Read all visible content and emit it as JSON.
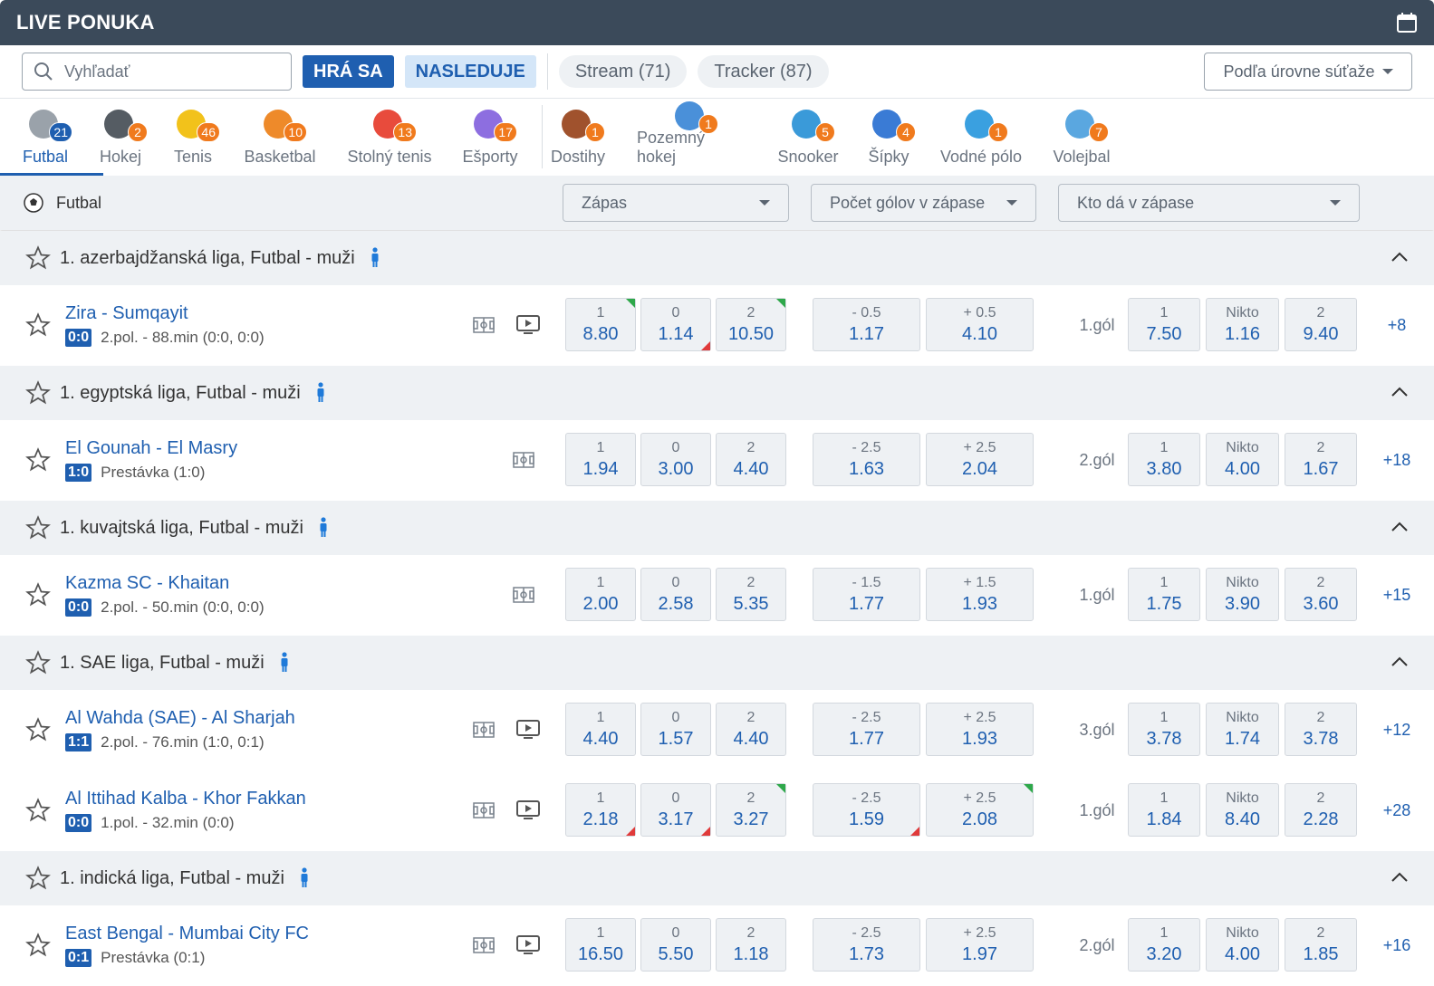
{
  "header": {
    "title": "LIVE PONUKA"
  },
  "filters": {
    "search_placeholder": "Vyhľadať",
    "playing_label": "HRÁ SA",
    "upcoming_label": "NASLEDUJE",
    "stream_label": "Stream (71)",
    "tracker_label": "Tracker (87)",
    "sort_label": "Podľa úrovne súťaže"
  },
  "sports": [
    {
      "name": "Futbal",
      "count": "21",
      "color": "#9aa2aa"
    },
    {
      "name": "Hokej",
      "count": "2",
      "color": "#555c63"
    },
    {
      "name": "Tenis",
      "count": "46",
      "color": "#f2c21b"
    },
    {
      "name": "Basketbal",
      "count": "10",
      "color": "#ee8a2a"
    },
    {
      "name": "Stolný tenis",
      "count": "13",
      "color": "#e84b3c"
    },
    {
      "name": "Ešporty",
      "count": "17",
      "color": "#8d6ee0"
    },
    {
      "name": "Dostihy",
      "count": "1",
      "color": "#a0522d"
    },
    {
      "name": "Pozemný hokej",
      "count": "1",
      "color": "#4a90d9"
    },
    {
      "name": "Snooker",
      "count": "5",
      "color": "#3a9ad9"
    },
    {
      "name": "Šípky",
      "count": "4",
      "color": "#3a7bd5"
    },
    {
      "name": "Vodné pólo",
      "count": "1",
      "color": "#3aa0e0"
    },
    {
      "name": "Volejbal",
      "count": "7",
      "color": "#5aa7e0"
    }
  ],
  "market_bar": {
    "sport_label": "Futbal",
    "dd1": "Zápas",
    "dd2": "Počet gólov v zápase",
    "dd3": "Kto dá v zápase"
  },
  "leagues": [
    {
      "name": "1. azerbajdžanská liga, Futbal - muži",
      "matches": [
        {
          "teams": "Zira - Sumqayit",
          "score": "0:0",
          "status": "2.pol. - 88.min (0:0, 0:0)",
          "tv": true,
          "odds": [
            {
              "l": "1",
              "v": "8.80"
            },
            {
              "l": "0",
              "v": "1.14"
            },
            {
              "l": "2",
              "v": "10.50"
            },
            {
              "l": "- 0.5",
              "v": "1.17"
            },
            {
              "l": "+ 0.5",
              "v": "4.10"
            }
          ],
          "goal": "1.gól",
          "odds2": [
            {
              "l": "1",
              "v": "7.50"
            },
            {
              "l": "Nikto",
              "v": "1.16"
            },
            {
              "l": "2",
              "v": "9.40"
            }
          ],
          "more": "+8"
        }
      ]
    },
    {
      "name": "1. egyptská liga, Futbal - muži",
      "matches": [
        {
          "teams": "El Gounah - El Masry",
          "score": "1:0",
          "status": "Prestávka (1:0)",
          "tv": false,
          "odds": [
            {
              "l": "1",
              "v": "1.94"
            },
            {
              "l": "0",
              "v": "3.00"
            },
            {
              "l": "2",
              "v": "4.40"
            },
            {
              "l": "- 2.5",
              "v": "1.63"
            },
            {
              "l": "+ 2.5",
              "v": "2.04"
            }
          ],
          "goal": "2.gól",
          "odds2": [
            {
              "l": "1",
              "v": "3.80"
            },
            {
              "l": "Nikto",
              "v": "4.00"
            },
            {
              "l": "2",
              "v": "1.67"
            }
          ],
          "more": "+18"
        }
      ]
    },
    {
      "name": "1. kuvajtská liga, Futbal - muži",
      "matches": [
        {
          "teams": "Kazma SC - Khaitan",
          "score": "0:0",
          "status": "2.pol. - 50.min (0:0, 0:0)",
          "tv": false,
          "odds": [
            {
              "l": "1",
              "v": "2.00"
            },
            {
              "l": "0",
              "v": "2.58"
            },
            {
              "l": "2",
              "v": "5.35"
            },
            {
              "l": "- 1.5",
              "v": "1.77"
            },
            {
              "l": "+ 1.5",
              "v": "1.93"
            }
          ],
          "goal": "1.gól",
          "odds2": [
            {
              "l": "1",
              "v": "1.75"
            },
            {
              "l": "Nikto",
              "v": "3.90"
            },
            {
              "l": "2",
              "v": "3.60"
            }
          ],
          "more": "+15"
        }
      ]
    },
    {
      "name": "1. SAE liga, Futbal - muži",
      "matches": [
        {
          "teams": "Al Wahda (SAE) - Al Sharjah",
          "score": "1:1",
          "status": "2.pol. - 76.min (1:0, 0:1)",
          "tv": true,
          "odds": [
            {
              "l": "1",
              "v": "4.40"
            },
            {
              "l": "0",
              "v": "1.57"
            },
            {
              "l": "2",
              "v": "4.40"
            },
            {
              "l": "- 2.5",
              "v": "1.77"
            },
            {
              "l": "+ 2.5",
              "v": "1.93"
            }
          ],
          "goal": "3.gól",
          "odds2": [
            {
              "l": "1",
              "v": "3.78"
            },
            {
              "l": "Nikto",
              "v": "1.74"
            },
            {
              "l": "2",
              "v": "3.78"
            }
          ],
          "more": "+12"
        },
        {
          "teams": "Al Ittihad Kalba - Khor Fakkan",
          "score": "0:0",
          "status": "1.pol. - 32.min (0:0)",
          "tv": true,
          "odds": [
            {
              "l": "1",
              "v": "2.18"
            },
            {
              "l": "0",
              "v": "3.17"
            },
            {
              "l": "2",
              "v": "3.27"
            },
            {
              "l": "- 2.5",
              "v": "1.59"
            },
            {
              "l": "+ 2.5",
              "v": "2.08"
            }
          ],
          "goal": "1.gól",
          "odds2": [
            {
              "l": "1",
              "v": "1.84"
            },
            {
              "l": "Nikto",
              "v": "8.40"
            },
            {
              "l": "2",
              "v": "2.28"
            }
          ],
          "more": "+28"
        }
      ]
    },
    {
      "name": "1. indická liga, Futbal - muži",
      "matches": [
        {
          "teams": "East Bengal - Mumbai City FC",
          "score": "0:1",
          "status": "Prestávka (0:1)",
          "tv": true,
          "odds": [
            {
              "l": "1",
              "v": "16.50"
            },
            {
              "l": "0",
              "v": "5.50"
            },
            {
              "l": "2",
              "v": "1.18"
            },
            {
              "l": "- 2.5",
              "v": "1.73"
            },
            {
              "l": "+ 2.5",
              "v": "1.97"
            }
          ],
          "goal": "2.gól",
          "odds2": [
            {
              "l": "1",
              "v": "3.20"
            },
            {
              "l": "Nikto",
              "v": "4.00"
            },
            {
              "l": "2",
              "v": "1.85"
            }
          ],
          "more": "+16"
        }
      ]
    }
  ]
}
